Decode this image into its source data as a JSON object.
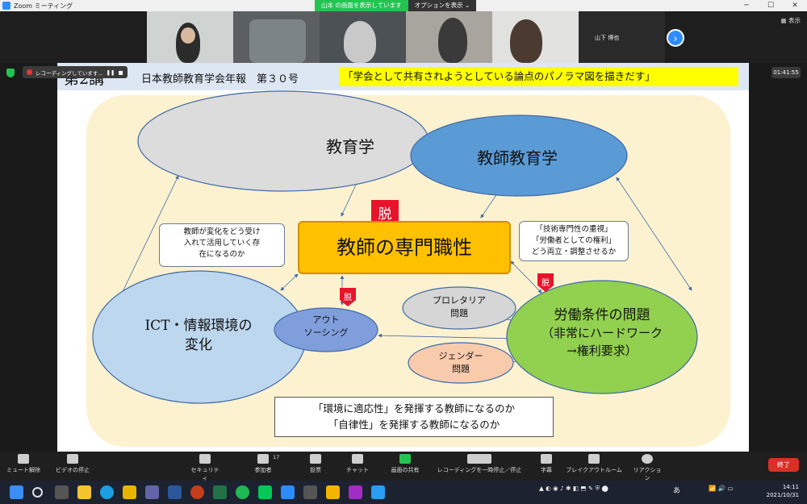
{
  "window": {
    "title": "Zoom ミーティング",
    "share_status": "山本 の画面を表示しています",
    "options_label": "オプションを表示",
    "view_label": "表示"
  },
  "participants": [
    {
      "name": ""
    },
    {
      "name": ""
    },
    {
      "name": ""
    },
    {
      "name": ""
    },
    {
      "name": ""
    },
    {
      "name": "山下 博也"
    }
  ],
  "recording": {
    "label": "レコーディングしています..."
  },
  "timer": "01:41:55",
  "slide": {
    "lecture": "第2講",
    "journal": "日本教師教育学会年報　第３０号",
    "slogan": "「学会として共有されようとしている論点のパノラマ図を描きだす」",
    "nodes": {
      "kyouikugaku": "教育学",
      "kyoshi_kyouikugaku": "教師教育学",
      "center": "教師の専門職性",
      "ict_line1": "ICT・情報環境の",
      "ict_line2": "変化",
      "outsourcing_line1": "アウト",
      "outsourcing_line2": "ソーシング",
      "rodo_line1": "労働条件の問題",
      "rodo_line2": "（非常にハードワーク",
      "rodo_line3": "→権利要求）",
      "proletaria_line1": "プロレタリア",
      "proletaria_line2": "問題",
      "gender_line1": "ジェンダー",
      "gender_line2": "問題"
    },
    "datsu": "脱",
    "callout_left": [
      "教師が変化をどう受け",
      "入れて活用していく存",
      "在になるのか"
    ],
    "callout_right": [
      "「技術専門性の重視」",
      "「労働者としての権利」",
      "どう両立・調整させるか"
    ],
    "bottom": [
      "「環境に適応性」を発揮する教師になるのか",
      "「自律性」を発揮する教師になるのか"
    ]
  },
  "toolbar": {
    "mute": "ミュート解除",
    "video": "ビデオの停止",
    "security": "セキュリティ",
    "participants": "参加者",
    "participants_count": "17",
    "poll": "投票",
    "chat": "チャット",
    "share": "画面の共有",
    "recording": "レコーディングを一時停止／停止",
    "caption": "字幕",
    "breakout": "ブレイクアウトルーム",
    "reaction": "リアクション",
    "end": "終了"
  },
  "taskbar": {
    "time": "14:11",
    "date": "2021/10/31",
    "ime": "あ"
  },
  "colors": {
    "zoom_blue": "#2d8cff",
    "share_green": "#23c552",
    "end_red": "#d93025",
    "slogan_yellow": "#ffff00",
    "center_orange": "#ffc000"
  }
}
